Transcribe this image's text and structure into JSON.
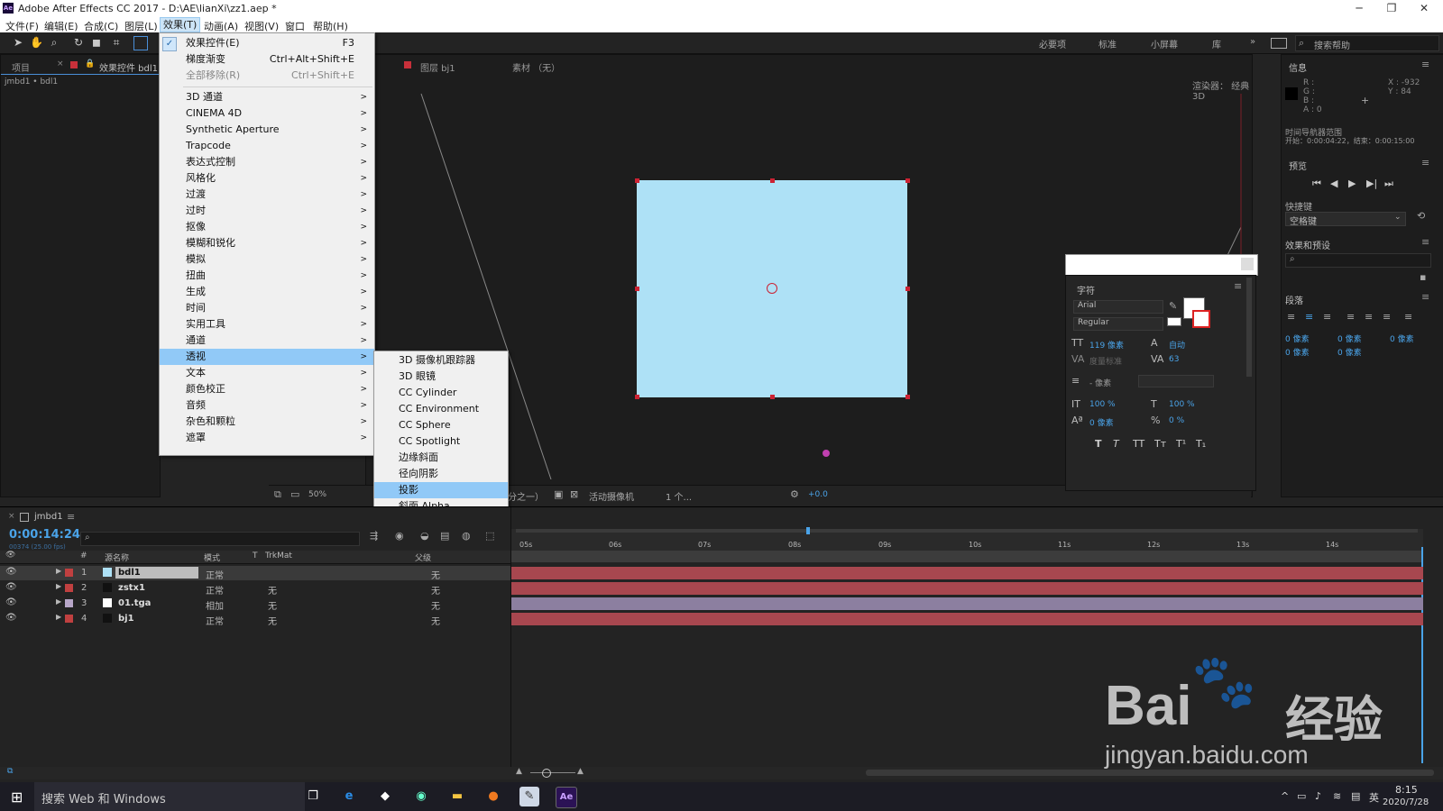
{
  "window": {
    "title": "Adobe After Effects CC 2017 - D:\\AE\\lianXi\\zz1.aep *",
    "logo": "Ae",
    "min": "─",
    "max": "❐",
    "close": "✕"
  },
  "menubar": [
    "文件(F)",
    "编辑(E)",
    "合成(C)",
    "图层(L)",
    "效果(T)",
    "动画(A)",
    "视图(V)",
    "窗口",
    "帮助(H)"
  ],
  "toolbar": {
    "workspaces": [
      "必要项",
      "标准",
      "小屏幕",
      "库"
    ],
    "search_placeholder": "搜索帮助"
  },
  "left_panel": {
    "tab_project": "项目",
    "tab_effects": "效果控件 bdl1",
    "breadcrumb": "jmbd1 • bdl1"
  },
  "effects_menu": {
    "top_items": [
      {
        "label": "效果控件(E)",
        "shortcut": "F3",
        "checked": true
      },
      {
        "label": "梯度渐变",
        "shortcut": "Ctrl+Alt+Shift+E"
      },
      {
        "label": "全部移除(R)",
        "shortcut": "Ctrl+Shift+E",
        "disabled": true
      }
    ],
    "items": [
      "3D 通道",
      "CINEMA 4D",
      "Synthetic Aperture",
      "Trapcode",
      "表达式控制",
      "风格化",
      "过渡",
      "过时",
      "抠像",
      "模糊和锐化",
      "模拟",
      "扭曲",
      "生成",
      "时间",
      "实用工具",
      "通道",
      "透视",
      "文本",
      "颜色校正",
      "音频",
      "杂色和颗粒",
      "遮罩"
    ],
    "highlighted": "透视"
  },
  "submenu": {
    "items": [
      "3D 摄像机跟踪器",
      "3D 眼镜",
      "CC Cylinder",
      "CC Environment",
      "CC Sphere",
      "CC Spotlight",
      "边缘斜面",
      "径向阴影",
      "投影",
      "斜面 Alpha"
    ],
    "highlighted": "投影"
  },
  "viewer": {
    "tab_layer": "图层 bj1",
    "tab_footage": "素材 （无）",
    "renderer": "渲染器：  经典 3D",
    "zoom": "50%",
    "resolution_fragment": "分之一）",
    "camera": "活动摄像机",
    "views": "1 个...",
    "exposure": "+0.0"
  },
  "info_panel": {
    "title": "信息",
    "r": "R :",
    "g": "G :",
    "b": "B :",
    "a": "A : 0",
    "x": "X : -932",
    "y": "Y : 84",
    "nav_range": "时间导航器范围",
    "nav_values": "开始：0:00:04:22，结束：0:00:15:00"
  },
  "preview_panel": {
    "title": "预览",
    "shortcut_label": "快捷键",
    "shortcut_value": "空格键"
  },
  "effects_presets": {
    "title": "效果和预设"
  },
  "paragraph_panel": {
    "title": "段落",
    "px1": "0 像素",
    "px2": "0 像素",
    "px3": "0 像素",
    "px4": "0 像素",
    "px5": "0 像素"
  },
  "char_panel": {
    "title": "字符",
    "font": "Arial",
    "style": "Regular",
    "size": "119 像素",
    "leading": "自动",
    "kerning": "度量标准",
    "tracking": "63",
    "stroke": "- 像素",
    "vscale": "100 %",
    "hscale": "100 %",
    "baseline": "0 像素",
    "tsume": "0 %",
    "styles": [
      "T",
      "T",
      "TT",
      "Tт",
      "T¹",
      "T₁"
    ]
  },
  "timeline": {
    "comp_tab": "jmbd1",
    "timecode": "0:00:14:24",
    "timecode_sub": "00374 (25.00 fps)",
    "headers": {
      "source_name": "源名称",
      "mode": "模式",
      "t": "T",
      "trkmat": "TrkMat",
      "parent": "父级",
      "num": "#"
    },
    "ruler": [
      "05s",
      "06s",
      "07s",
      "08s",
      "09s",
      "10s",
      "11s",
      "12s",
      "13s",
      "14s"
    ],
    "layers": [
      {
        "num": "1",
        "name": "bdl1",
        "mode": "正常",
        "trkmat": "",
        "parent": "无",
        "color": "#b94a4a",
        "swatch": "#aee1f6",
        "bar": "#a8474f"
      },
      {
        "num": "2",
        "name": "zstx1",
        "mode": "正常",
        "trkmat": "无",
        "parent": "无",
        "color": "#b94a4a",
        "swatch": "#111111",
        "bar": "#a8474f"
      },
      {
        "num": "3",
        "name": "01.tga",
        "mode": "相加",
        "trkmat": "无",
        "parent": "无",
        "color": "#b7a6c8",
        "swatch": "#ffffff",
        "bar": "#8c7fa0"
      },
      {
        "num": "4",
        "name": "bj1",
        "mode": "正常",
        "trkmat": "无",
        "parent": "无",
        "color": "#b94a4a",
        "swatch": "#111111",
        "bar": "#a8474f"
      }
    ]
  },
  "taskbar": {
    "search": "搜索 Web 和 Windows",
    "time": "8:15",
    "date": "2020/7/28",
    "lang": "英"
  },
  "watermark": {
    "brand": "Bai",
    "brand2": "经验",
    "url": "jingyan.baidu.com"
  },
  "colors": {
    "accent": "#91c9f7",
    "solid": "#aee1f6",
    "layer_red": "#a8474f",
    "timecode": "#4aa3e8"
  }
}
